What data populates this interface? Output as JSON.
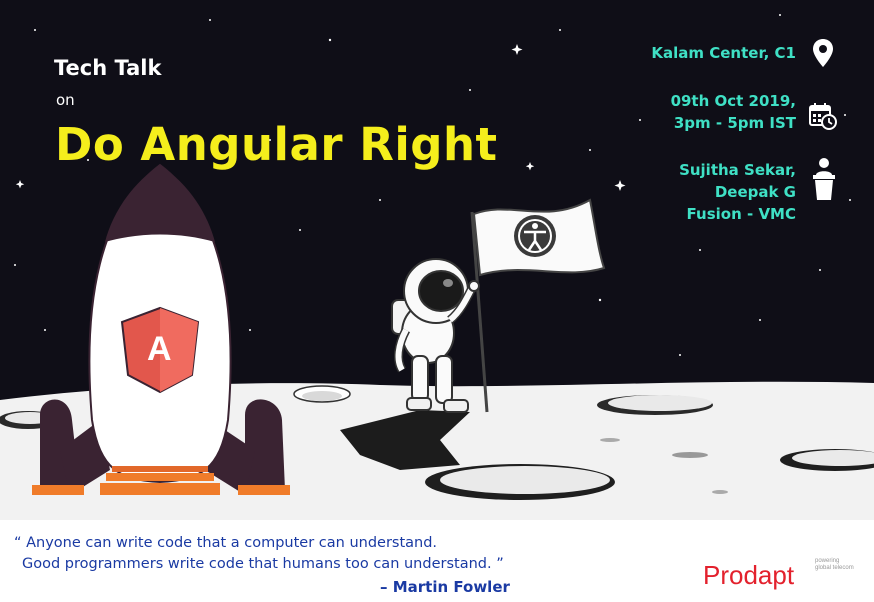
{
  "event": {
    "label": "Tech Talk",
    "connector": "on",
    "title": "Do Angular Right"
  },
  "details": {
    "venue": "Kalam Center, C1",
    "date_line1": "09th Oct 2019,",
    "date_line2": "3pm - 5pm IST",
    "speaker1": "Sujitha Sekar,",
    "speaker2": "Deepak G",
    "team": "Fusion - VMC"
  },
  "quote": {
    "line1": "“ Anyone can write code that a computer can understand.",
    "line2": "Good programmers write code that humans too can understand. ”",
    "author": "– Martin Fowler"
  },
  "brand": {
    "name": "Prodapt",
    "tagline_line1": "powering",
    "tagline_line2": "global telecom"
  },
  "rocket_badge": "A",
  "colors": {
    "background": "#0f0e17",
    "title": "#f5ee1c",
    "info": "#3fe0c5",
    "quote": "#1a3aa3",
    "brand": "#e3212d",
    "rocket_fin": "#3a2332",
    "rocket_base": "#f07c2a",
    "angular_badge": "#e2574c"
  },
  "icons": [
    "location-pin-icon",
    "calendar-clock-icon",
    "podium-speaker-icon",
    "accessibility-icon"
  ]
}
